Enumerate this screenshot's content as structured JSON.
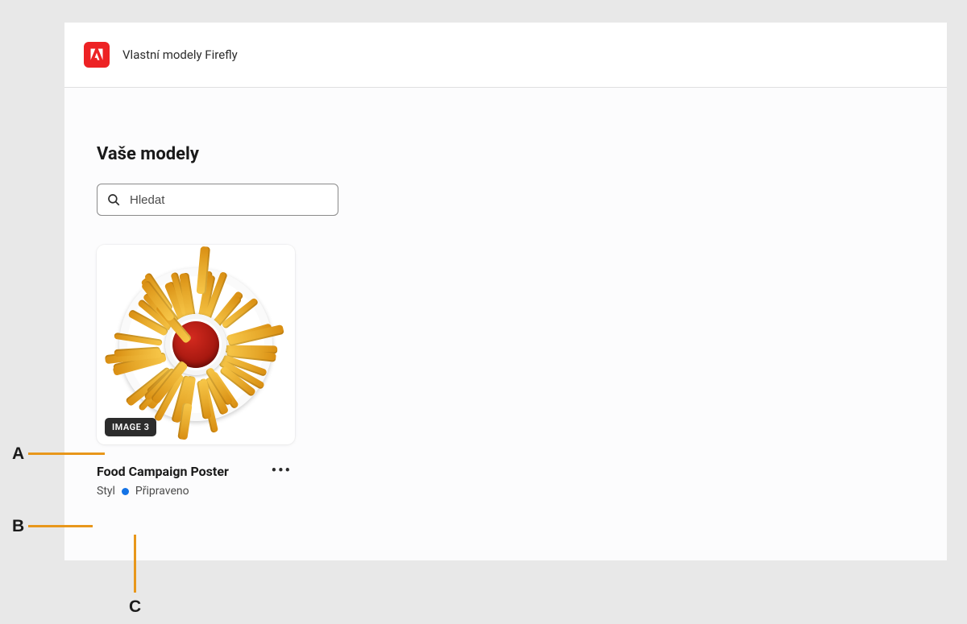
{
  "header": {
    "title": "Vlastní modely Firefly",
    "icon": "adobe-logo-icon"
  },
  "panel": {
    "title": "Vaše modely"
  },
  "search": {
    "placeholder": "Hledat",
    "value": ""
  },
  "card": {
    "thumbnail_description": "french-fries-with-ketchup",
    "badge": "IMAGE 3",
    "title": "Food Campaign Poster",
    "type": "Styl",
    "status": "Připraveno",
    "status_color": "#1473e6"
  },
  "callouts": {
    "a": "A",
    "b": "B",
    "c": "C"
  }
}
